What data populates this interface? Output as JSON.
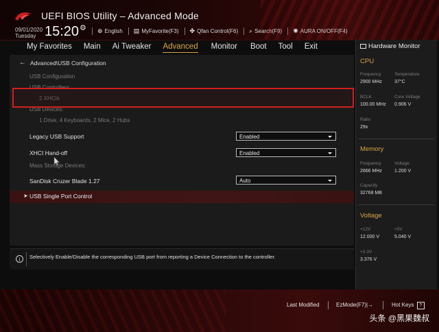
{
  "header": {
    "title": "UEFI BIOS Utility – Advanced Mode",
    "date": "09/01/2020",
    "day": "Tuesday",
    "time": "15:20",
    "tools": [
      {
        "icon": "globe-icon",
        "label": "English"
      },
      {
        "icon": "favorite-icon",
        "label": "MyFavorite(F3)"
      },
      {
        "icon": "fan-icon",
        "label": "Qfan Control(F6)"
      },
      {
        "icon": "search-icon",
        "label": "Search(F9)"
      },
      {
        "icon": "aura-icon",
        "label": "AURA ON/OFF(F4)"
      }
    ]
  },
  "nav": {
    "tabs": [
      "My Favorites",
      "Main",
      "Ai Tweaker",
      "Advanced",
      "Monitor",
      "Boot",
      "Tool",
      "Exit"
    ],
    "active": "Advanced"
  },
  "main": {
    "breadcrumb": "Advanced\\USB Configuration",
    "info": {
      "usb_configuration": "USB Configuration",
      "usb_controllers": "USB Controllers:",
      "controllers_value": "2 XHCIs",
      "usb_devices": "USB Devices:",
      "devices_value": "1 Drive, 4 Keyboards, 2 Mice, 2 Hubs"
    },
    "settings": {
      "legacy": {
        "label": "Legacy USB Support",
        "value": "Enabled"
      },
      "xhci": {
        "label": "XHCI Hand-off",
        "value": "Enabled"
      },
      "mass_storage": "Mass Storage Devices:",
      "sandisk": {
        "label": "SanDisk Cruzer Blade 1.27",
        "value": "Auto"
      }
    },
    "submenu": "USB Single Port Control"
  },
  "help": {
    "text": "Selectively Enable/Disable the corresponding USB port from reporting a Device Connection to the controller."
  },
  "hardware_monitor": {
    "title": "Hardware Monitor",
    "cpu": {
      "section": "CPU",
      "frequency_label": "Frequency",
      "frequency": "2900 MHz",
      "temperature_label": "Temperature",
      "temperature": "37°C",
      "bclk_label": "BCLK",
      "bclk": "100.00 MHz",
      "core_voltage_label": "Core Voltage",
      "core_voltage": "0.906 V",
      "ratio_label": "Ratio",
      "ratio": "29x"
    },
    "memory": {
      "section": "Memory",
      "frequency_label": "Frequency",
      "frequency": "2666 MHz",
      "voltage_label": "Voltage",
      "voltage": "1.200 V",
      "capacity_label": "Capacity",
      "capacity": "32768 MB"
    },
    "voltage": {
      "section": "Voltage",
      "v12_label": "+12V",
      "v12": "12.000 V",
      "v5_label": "+5V",
      "v5": "5.040 V",
      "v33_label": "+3.3V",
      "v33": "3.376 V"
    }
  },
  "footer": {
    "last_modified": "Last Modified",
    "ezmode": "EzMode(F7)|→",
    "hot_keys": "Hot Keys",
    "hot_keys_icon": "?",
    "watermark": "头条 @黑果魏叔"
  },
  "colors": {
    "accent": "#d8a54a",
    "highlight_border": "#d21f1f",
    "submenu_bg": "#3a1212"
  }
}
